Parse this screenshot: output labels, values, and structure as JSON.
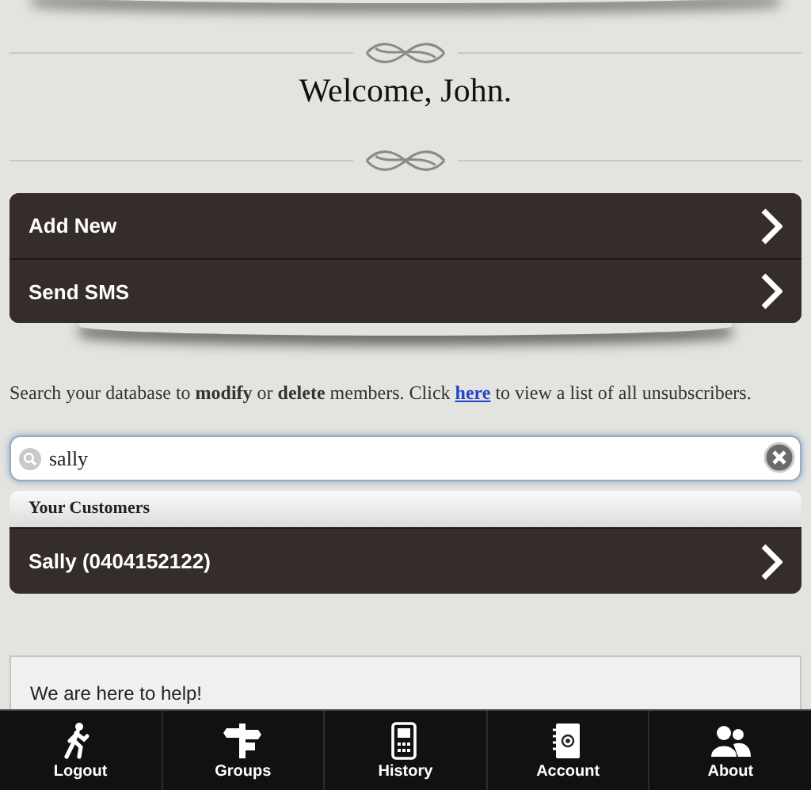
{
  "heading": "Welcome, John.",
  "menu": [
    {
      "label": "Add New"
    },
    {
      "label": "Send SMS"
    }
  ],
  "intro": "Search your database to **modify** or **delete** members. Click ",
  "intro_link": "here",
  "intro_end": " to view a list of all unsubscribers.",
  "search": {
    "value": "sally"
  },
  "results": {
    "header": "Your Customers",
    "items": [
      {
        "label": "Sally (0404152122)"
      }
    ]
  },
  "help": {
    "title": "We are here to help!"
  },
  "navbar": [
    {
      "label": "Logout",
      "kind": "walk"
    },
    {
      "label": "Groups",
      "kind": "signpost"
    },
    {
      "label": "History",
      "kind": "phone"
    },
    {
      "label": "Account",
      "kind": "addressbook"
    },
    {
      "label": "About",
      "kind": "people"
    }
  ]
}
